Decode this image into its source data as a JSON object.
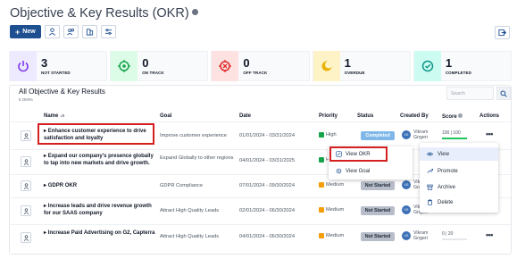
{
  "page": {
    "title": "Objective & Key Results (OKR)"
  },
  "toolbar": {
    "new_label": "New"
  },
  "stats": [
    {
      "value": "3",
      "label": "NOT STARTED",
      "color": "#7c3aed",
      "icon": "power-icon",
      "bg": "#ede9fe"
    },
    {
      "value": "0",
      "label": "ON TRACK",
      "color": "#16a34a",
      "icon": "target-icon",
      "bg": "#dcfce7"
    },
    {
      "value": "0",
      "label": "OFF TRACK",
      "color": "#dc2626",
      "icon": "crosshair-icon",
      "bg": "#fee2e2"
    },
    {
      "value": "1",
      "label": "OVERDUE",
      "color": "#ca8a04",
      "icon": "moon-icon",
      "bg": "#fef3c7"
    },
    {
      "value": "1",
      "label": "COMPLETED",
      "color": "#0d9488",
      "icon": "check-circle-icon",
      "bg": "#ccfbf1"
    }
  ],
  "list": {
    "title": "All Objective & Key Results",
    "subtitle": "5 OKRs",
    "search_placeholder": "Search",
    "columns": {
      "name": "Name",
      "goal": "Goal",
      "date": "Date",
      "priority": "Priority",
      "status": "Status",
      "created_by": "Created By",
      "score": "Score",
      "actions": "Actions"
    },
    "rows": [
      {
        "name": "Enhance customer experience to drive satisfaction and loyalty",
        "goal": "Improve customer experience",
        "date": "01/01/2024 - 03/31/2024",
        "priority": "High",
        "priority_color": "#16a34a",
        "status": "Completed",
        "owner": "Vikram Gngeri",
        "owner_initials": "VG",
        "score": "100 | 100",
        "score_pct": 100
      },
      {
        "name": "Expand our company's presence globally to tap into new markets and drive growth.",
        "goal": "Expand Globally to other regions",
        "date": "04/01/2024 - 03/31/2025",
        "priority": "Hig",
        "priority_color": "#16a34a",
        "status": "",
        "owner": "",
        "owner_initials": "",
        "score": "",
        "score_pct": 0
      },
      {
        "name": "GDPR OKR",
        "goal": "GDPR Compliance",
        "date": "07/01/2024 - 09/30/2024",
        "priority": "Medium",
        "priority_color": "#f59e0b",
        "status": "Not Started",
        "owner": "Vikram Gngeri",
        "owner_initials": "VG",
        "score": "",
        "score_pct": 0
      },
      {
        "name": "Increase leads and drive revenue growth for our SAAS company",
        "goal": "Attract High Quality Leads",
        "date": "02/01/2024 - 06/30/2024",
        "priority": "Medium",
        "priority_color": "#f59e0b",
        "status": "Not Started",
        "owner": "Vikram Gngeri",
        "owner_initials": "VG",
        "score": "",
        "score_pct": 0
      },
      {
        "name": "Increase Paid Advertising on G2, Capterra",
        "goal": "Attract High Quality Leads",
        "date": "04/01/2024 - 06/30/2024",
        "priority": "Medium",
        "priority_color": "#f59e0b",
        "status": "Not Started",
        "owner": "Vikram Gngeri",
        "owner_initials": "VG",
        "score": "0 | 20",
        "score_pct": 0
      }
    ]
  },
  "submenu": {
    "view_okr": "View OKR",
    "view_goal": "View Goal"
  },
  "actions_menu": {
    "view": "View",
    "promote": "Promote",
    "archive": "Archive",
    "delete": "Delete"
  },
  "colors": {
    "primary": "#1d4f91",
    "highlight": "#d42020"
  }
}
